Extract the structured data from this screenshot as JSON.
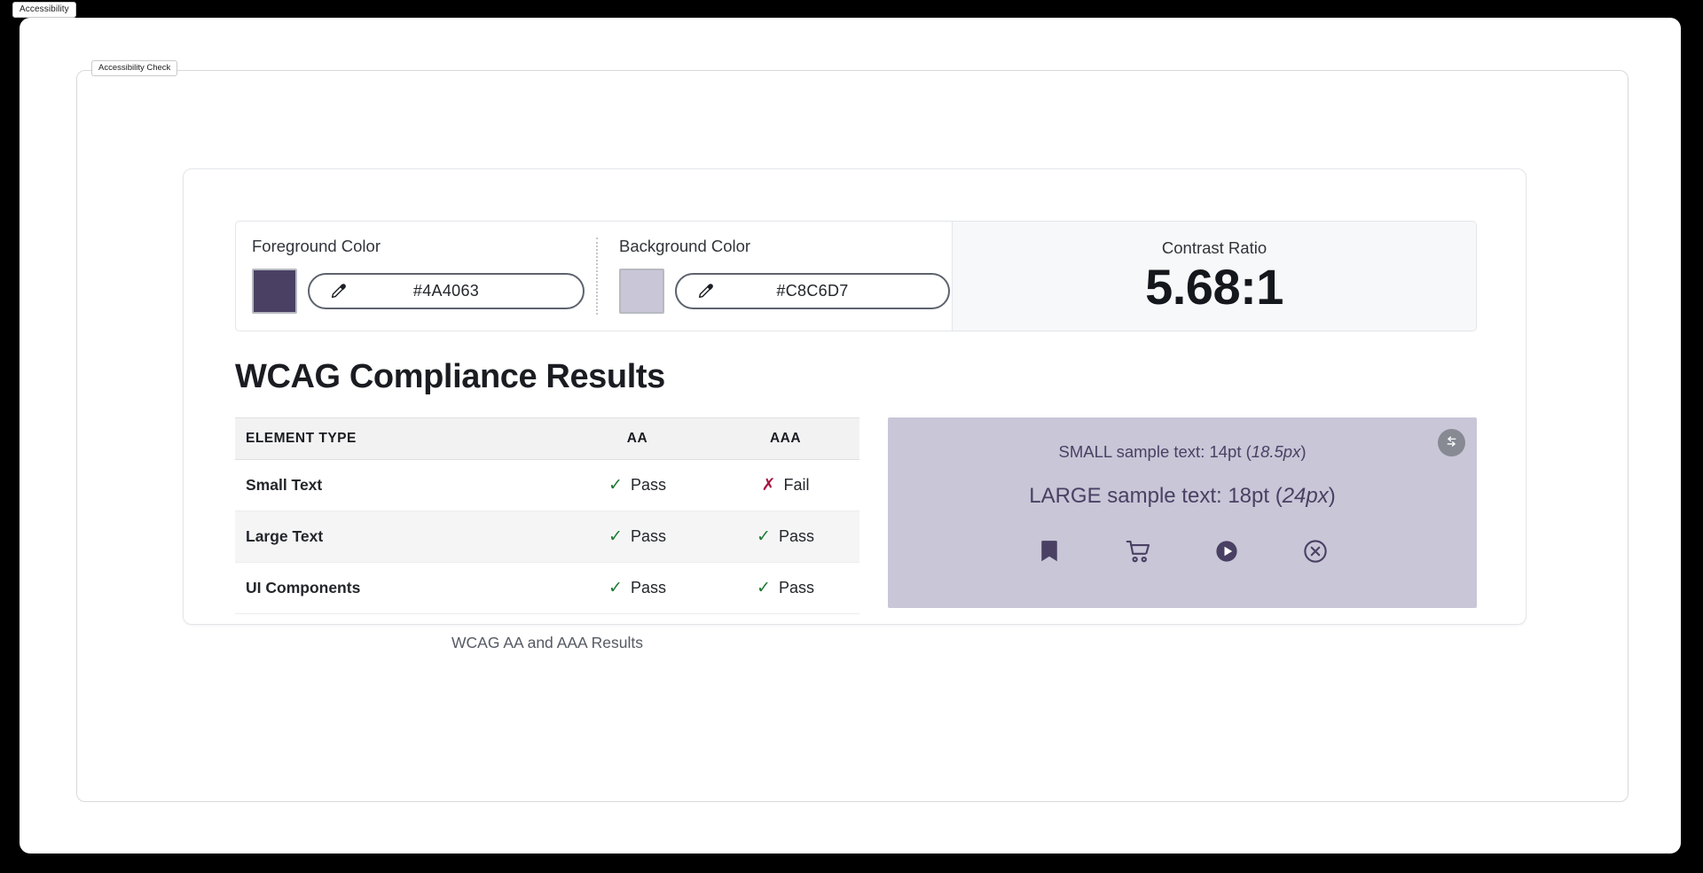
{
  "window": {
    "tab_label": "Accessibility",
    "region_tab_label": "Accessibility Check"
  },
  "colors": {
    "foreground": {
      "label": "Foreground Color",
      "value": "#4A4063",
      "swatch_hex": "#4A4063",
      "dropper_icon": "eyedropper-icon"
    },
    "background": {
      "label": "Background Color",
      "value": "#C8C6D7",
      "swatch_hex": "#C8C6D7",
      "dropper_icon": "eyedropper-icon"
    }
  },
  "contrast": {
    "label": "Contrast Ratio",
    "value": "5.68:1"
  },
  "results": {
    "heading": "WCAG Compliance Results",
    "caption": "WCAG AA and AAA Results",
    "columns": {
      "type": "ELEMENT TYPE",
      "aa": "AA",
      "aaa": "AAA"
    },
    "pass_label": "Pass",
    "fail_label": "Fail",
    "pass_color": "#1E7A32",
    "fail_color": "#A6173F",
    "rows": [
      {
        "type": "Small Text",
        "aa": "Pass",
        "aa_state": "pass",
        "aaa": "Fail",
        "aaa_state": "fail"
      },
      {
        "type": "Large Text",
        "aa": "Pass",
        "aa_state": "pass",
        "aaa": "Pass",
        "aaa_state": "pass"
      },
      {
        "type": "UI Components",
        "aa": "Pass",
        "aa_state": "pass",
        "aaa": "Pass",
        "aaa_state": "pass"
      }
    ]
  },
  "preview": {
    "background_hex": "#C8C6D7",
    "text_hex": "#4A4063",
    "small_text_prefix": "SMALL sample text: 14pt (",
    "small_text_px": "18.5px",
    "small_text_suffix": ")",
    "large_text_prefix": "LARGE sample text: 18pt (",
    "large_text_px": "24px",
    "large_text_suffix": ")",
    "swap_button": "swap-colors-icon",
    "icons": [
      "bookmark-icon",
      "shopping-cart-icon",
      "play-circle-icon",
      "close-circle-icon"
    ]
  }
}
